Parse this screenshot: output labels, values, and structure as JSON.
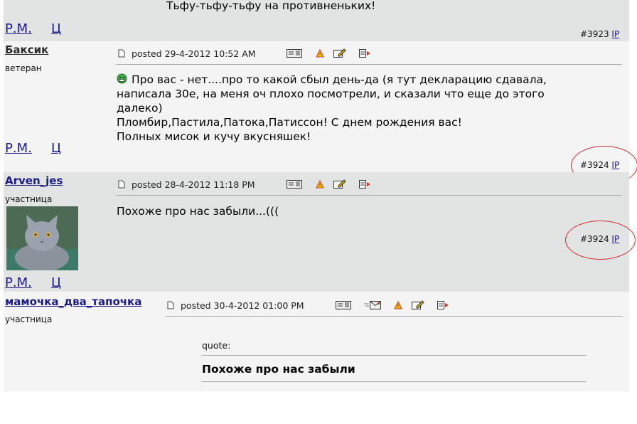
{
  "top_text": "Тьфу-тьфу-тьфу на противненьких!",
  "pm_label": "Р.М.",
  "c_label": "Ц",
  "ip_label": "IP",
  "posts": [
    {
      "number": "#3923"
    },
    {
      "username": "Баксик",
      "rank": "ветеран",
      "posted": "posted 29-4-2012 10:52 AM",
      "body": [
        "Про вас - нет....про то какой сбыл день-да (я тут декларацию сдавала,",
        "написала 30е, на меня оч плохо посмотрели, и сказали что еще до этого",
        "далеко)",
        "Пломбир,Пастила,Патока,Патиссон! С днем рождения вас!",
        "Полных мисок и кучу вкусняшек!"
      ],
      "number": "#3924"
    },
    {
      "username": "Arven_jes",
      "rank": "участница",
      "posted": "posted 28-4-2012 11:18 PM",
      "body": [
        "Похоже про нас забыли...((("
      ],
      "number": "#3924"
    },
    {
      "username": "мамочка_два_тапочка",
      "rank": "участница",
      "posted": "posted 30-4-2012 01:00 PM",
      "quote_label": "quote:",
      "quote_text": "Похоже про нас забыли"
    }
  ],
  "colors": {
    "gray_band": "#e2e3e3",
    "light_band": "#f4f4f4",
    "link": "#1a1a8c",
    "username_dark": "#2b2b2b",
    "annotation_circle": "#d32b2b"
  },
  "icons": [
    "document-icon",
    "profile-card-icon",
    "warning-icon",
    "edit-icon",
    "reply-icon",
    "email-icon",
    "smiley-icon",
    "avatar-cat"
  ]
}
